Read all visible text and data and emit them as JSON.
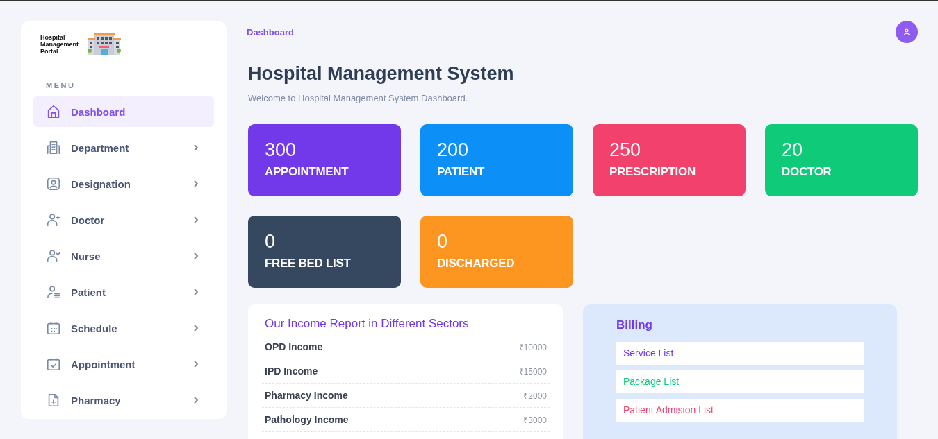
{
  "logo": {
    "text": "Hospital Management Portal"
  },
  "sidebar": {
    "heading": "MENU",
    "items": [
      {
        "label": "Dashboard",
        "kind": "home",
        "selected": true,
        "has_submenu": false
      },
      {
        "label": "Department",
        "kind": "building",
        "selected": false,
        "has_submenu": true
      },
      {
        "label": "Designation",
        "kind": "badge",
        "selected": false,
        "has_submenu": true
      },
      {
        "label": "Doctor",
        "kind": "user-plus",
        "selected": false,
        "has_submenu": true
      },
      {
        "label": "Nurse",
        "kind": "user-check",
        "selected": false,
        "has_submenu": true
      },
      {
        "label": "Patient",
        "kind": "user-list",
        "selected": false,
        "has_submenu": true
      },
      {
        "label": "Schedule",
        "kind": "calendar",
        "selected": false,
        "has_submenu": true
      },
      {
        "label": "Appointment",
        "kind": "calendar-check",
        "selected": false,
        "has_submenu": true
      },
      {
        "label": "Pharmacy",
        "kind": "file-plus",
        "selected": false,
        "has_submenu": true
      }
    ]
  },
  "breadcrumb": "Dashboard",
  "page": {
    "title": "Hospital Management System",
    "subtitle": "Welcome to Hospital Management System Dashboard."
  },
  "stats": [
    {
      "value": "300",
      "label": "APPOINTMENT",
      "color": "#7239ea"
    },
    {
      "value": "200",
      "label": "PATIENT",
      "color": "#0d8ff8"
    },
    {
      "value": "250",
      "label": "PRESCRIPTION",
      "color": "#f1416c"
    },
    {
      "value": "20",
      "label": "DOCTOR",
      "color": "#0fca78"
    },
    {
      "value": "0",
      "label": "FREE BED LIST",
      "color": "#354860"
    },
    {
      "value": "0",
      "label": "DISCHARGED",
      "color": "#fd9621"
    }
  ],
  "income_report": {
    "title": "Our Income Report in Different Sectors",
    "rows": [
      {
        "name": "OPD Income",
        "amount": "₹10000"
      },
      {
        "name": "IPD Income",
        "amount": "₹15000"
      },
      {
        "name": "Pharmacy Income",
        "amount": "₹2000"
      },
      {
        "name": "Pathology Income",
        "amount": "₹3000"
      }
    ]
  },
  "billing": {
    "toggle": "—",
    "title": "Billing",
    "expanded": true,
    "items": [
      {
        "label": "Service List",
        "color": "#7239ea"
      },
      {
        "label": "Package List",
        "color": "#0fca78"
      },
      {
        "label": "Patient Admision List",
        "color": "#f1416c"
      }
    ]
  }
}
